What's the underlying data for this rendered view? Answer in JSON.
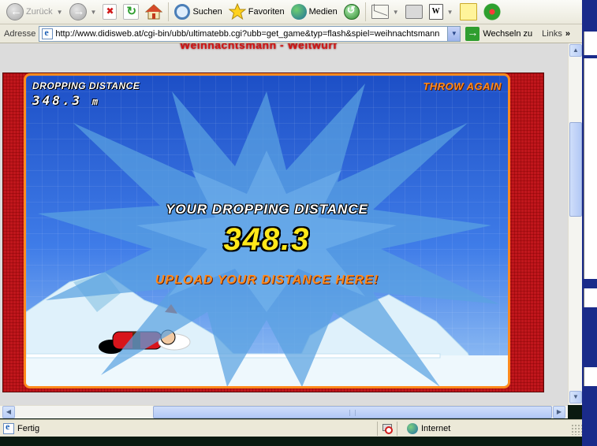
{
  "toolbar": {
    "back_label": "Zurück",
    "search_label": "Suchen",
    "favorites_label": "Favoriten",
    "media_label": "Medien"
  },
  "address_bar": {
    "label": "Adresse",
    "url": "http://www.didisweb.at/cgi-bin/ubb/ultimatebb.cgi?ubb=get_game&typ=flash&spiel=weihnachtsmann",
    "go_label": "Wechseln zu",
    "links_label": "Links"
  },
  "page": {
    "title_fragment": "Weihnachtsmann - Weitwurf"
  },
  "game": {
    "distance_label": "DROPPING DISTANCE",
    "distance_value": "348.3",
    "distance_unit": "m",
    "throw_again_label": "THROW AGAIN",
    "result_heading": "YOUR DROPPING DISTANCE",
    "result_value": "348.3",
    "upload_label": "UPLOAD YOUR DISTANCE HERE!"
  },
  "statusbar": {
    "status_text": "Fertig",
    "zone_label": "Internet"
  },
  "colors": {
    "game_orange": "#ff8a1e",
    "game_yellow": "#ffe81a",
    "frame_red": "#c0161c",
    "sky_blue": "#1d4fc6"
  },
  "icons": [
    "back-icon",
    "forward-icon",
    "stop-icon",
    "refresh-icon",
    "home-icon",
    "search-icon",
    "favorites-star-icon",
    "media-icon",
    "history-icon",
    "mail-icon",
    "print-icon",
    "edit-word-icon",
    "note-icon",
    "messenger-flower-icon",
    "page-icon",
    "go-arrow-icon",
    "blocked-popup-icon",
    "internet-globe-icon"
  ]
}
